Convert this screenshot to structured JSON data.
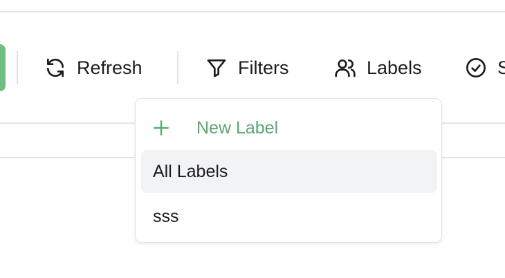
{
  "toolbar": {
    "refresh_label": "Refresh",
    "filters_label": "Filters",
    "labels_label": "Labels",
    "status_label": "S"
  },
  "labels_dropdown": {
    "new_label": "New Label",
    "items": [
      {
        "label": "All Labels",
        "highlighted": true
      },
      {
        "label": "sss",
        "highlighted": false
      }
    ]
  },
  "icons": {
    "refresh": "refresh-icon",
    "filters": "filter-icon",
    "labels": "users-icon",
    "status": "check-circle-icon",
    "new_label": "plus-icon"
  },
  "colors": {
    "accent_green": "#5aa874",
    "highlight_bg": "#f2f3f5",
    "left_button_green": "#6dbf82"
  }
}
